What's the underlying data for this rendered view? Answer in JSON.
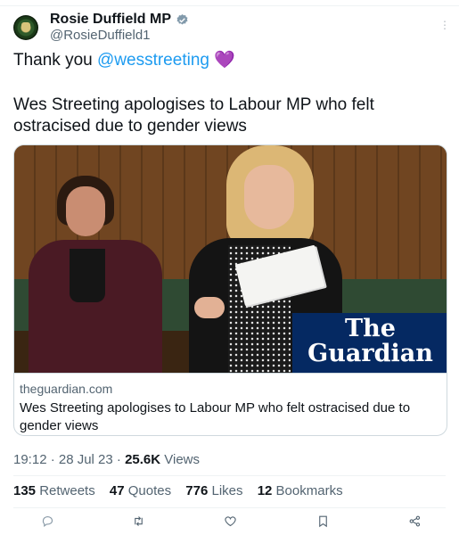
{
  "author": {
    "display_name": "Rosie Duffield MP",
    "handle": "@RosieDuffield1"
  },
  "tweet": {
    "text_prefix": "Thank you ",
    "mention": "@wesstreeting",
    "emoji": "💜",
    "headline_text": "Wes Streeting apologises to Labour MP who felt ostracised due to gender views"
  },
  "card": {
    "logo_line1": "The",
    "logo_line2": "Guardian",
    "domain": "theguardian.com",
    "title": "Wes Streeting apologises to Labour MP who felt ostracised due to gender views"
  },
  "meta": {
    "time_date": "19:12 · 28 Jul 23 · ",
    "views_count": "25.6K",
    "views_label": " Views"
  },
  "stats": {
    "retweets_count": "135",
    "retweets_label": " Retweets",
    "quotes_count": "47",
    "quotes_label": " Quotes",
    "likes_count": "776",
    "likes_label": " Likes",
    "bookmarks_count": "12",
    "bookmarks_label": " Bookmarks"
  },
  "actions": [
    {
      "icon": "reply-icon"
    },
    {
      "icon": "retweet-icon"
    },
    {
      "icon": "like-icon"
    },
    {
      "icon": "bookmark-icon"
    },
    {
      "icon": "share-icon"
    }
  ],
  "colors": {
    "link": "#1d9bf0",
    "verified": "#829aab",
    "guardian_blue": "#052962",
    "secondary_text": "#536471"
  }
}
